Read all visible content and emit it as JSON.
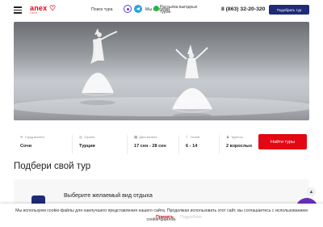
{
  "header": {
    "logo_text": "anex",
    "logo_sub": "TOUR",
    "search_tour": "Поиск тура",
    "contact_label": "Мы на связи",
    "newsletter_label": "Рассылка выгодных туров",
    "phone": "8 (863) 32-20-320",
    "pick_tour_button": "Подобрать тур",
    "icons": [
      "menu-icon",
      "vk-icon",
      "telegram-icon",
      "whatsapp-icon"
    ]
  },
  "search_form": {
    "fields": [
      {
        "label": "Город вылета",
        "value": "Сочи"
      },
      {
        "label": "Страна",
        "value": "Турция"
      },
      {
        "label": "Дата вылета",
        "value": "17 сен - 28 сен"
      },
      {
        "label": "Ночей",
        "value": "6 - 14"
      },
      {
        "label": "Туристы",
        "value": "2 взрослых"
      }
    ],
    "find_button": "Найти туры"
  },
  "section": {
    "title": "Подбери свой тур",
    "card_title": "Выберите желаемый вид отдыха"
  },
  "cookie": {
    "text": "Мы используем cookie-файлы для наилучшего представления нашего сайта. Продолжая использовать этот сайт, вы соглашаетесь с использованием cookie-файлов.",
    "accept": "Принять",
    "more": "Подробнее"
  },
  "colors": {
    "brand_red": "#e30613",
    "navy": "#1e2b76",
    "chat_purple": "#6a2fb8"
  }
}
